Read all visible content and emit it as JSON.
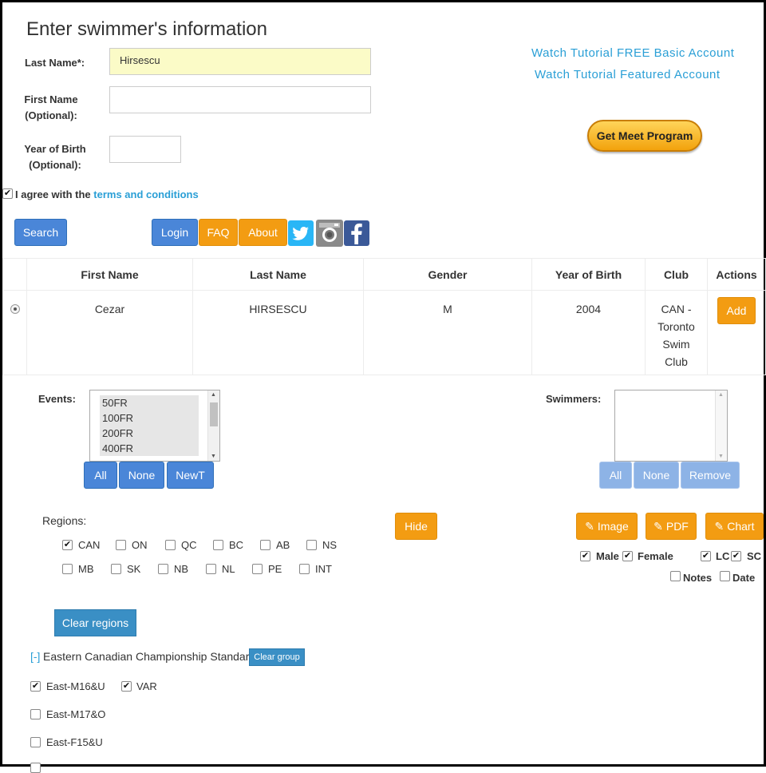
{
  "title": "Enter swimmer's information",
  "form": {
    "last_name_label": "Last Name*:",
    "last_name_value": "Hirsescu",
    "first_name_label_1": "First Name",
    "first_name_label_2": "(Optional):",
    "first_name_value": "",
    "yob_label_1": "Year of Birth",
    "yob_label_2": "(Optional):",
    "yob_value": "",
    "agree_text": "I agree with the",
    "terms_link": "terms and conditions",
    "agree_checked": true
  },
  "links": {
    "tutorial_basic": "Watch Tutorial FREE Basic Account",
    "tutorial_featured": "Watch Tutorial Featured Account"
  },
  "buttons": {
    "get_meet_program": "Get Meet Program",
    "search": "Search",
    "login": "Login",
    "faq": "FAQ",
    "about": "About"
  },
  "social": [
    "twitter-icon",
    "instagram-icon",
    "facebook-icon"
  ],
  "table": {
    "headers": [
      "First Name",
      "Last Name",
      "Gender",
      "Year of Birth",
      "Club",
      "Actions"
    ],
    "rows": [
      {
        "first_name": "Cezar",
        "last_name": "HIRSESCU",
        "gender": "M",
        "yob": "2004",
        "club": [
          "CAN -",
          "Toronto",
          "Swim",
          "Club"
        ],
        "action": "Add"
      }
    ]
  },
  "events": {
    "label": "Events:",
    "options": [
      "50FR",
      "100FR",
      "200FR",
      "400FR"
    ],
    "btn_all": "All",
    "btn_none": "None",
    "btn_newt": "NewT"
  },
  "swimmers": {
    "label": "Swimmers:",
    "btn_all": "All",
    "btn_none": "None",
    "btn_remove": "Remove"
  },
  "regions": {
    "label": "Regions:",
    "row1": [
      {
        "name": "CAN",
        "checked": true
      },
      {
        "name": "ON",
        "checked": false
      },
      {
        "name": "QC",
        "checked": false
      },
      {
        "name": "BC",
        "checked": false
      },
      {
        "name": "AB",
        "checked": false
      },
      {
        "name": "NS",
        "checked": false
      }
    ],
    "row2": [
      {
        "name": "MB",
        "checked": false
      },
      {
        "name": "SK",
        "checked": false
      },
      {
        "name": "NB",
        "checked": false
      },
      {
        "name": "NL",
        "checked": false
      },
      {
        "name": "PE",
        "checked": false
      },
      {
        "name": "INT",
        "checked": false
      }
    ],
    "hide_btn": "Hide",
    "clear_btn": "Clear regions"
  },
  "export": {
    "image": "Image",
    "pdf": "PDF",
    "chart": "Chart",
    "male": "Male",
    "female": "Female",
    "lc": "LC",
    "sc": "SC",
    "notes": "Notes",
    "date": "Date"
  },
  "group": {
    "toggle": "[-]",
    "name": "Eastern Canadian Championship Standards",
    "clear_btn": "Clear group",
    "items": [
      {
        "name": "East-M16&U",
        "checked": true
      },
      {
        "name": "VAR",
        "checked": true
      },
      {
        "name": "East-M17&O",
        "checked": false
      },
      {
        "name": "East-F15&U",
        "checked": false
      }
    ]
  },
  "colors": {
    "blue": "#4a86d8",
    "orange": "#f39c12",
    "link": "#2a9fd6",
    "yellow_input": "#fbfbc7"
  }
}
